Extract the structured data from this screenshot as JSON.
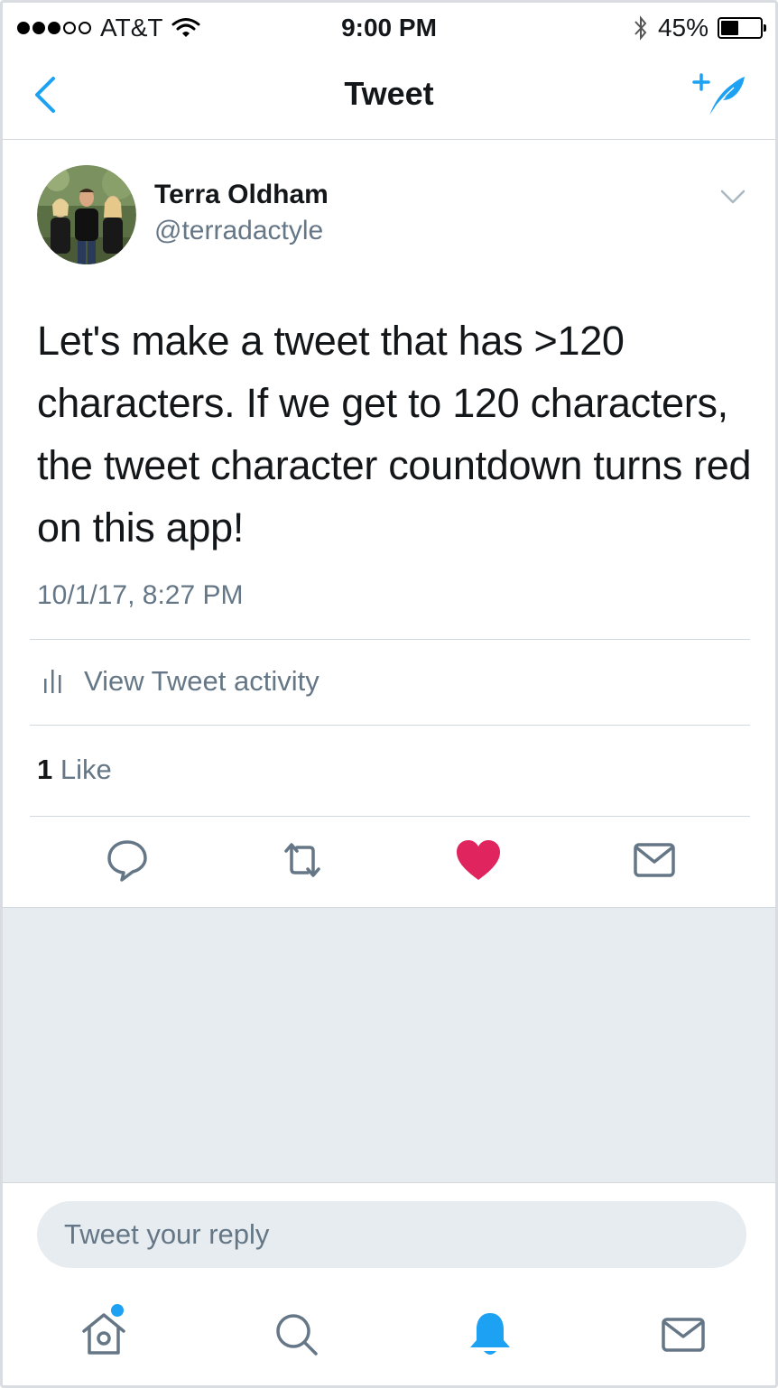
{
  "status_bar": {
    "carrier": "AT&T",
    "time": "9:00 PM",
    "battery": "45%",
    "battery_level": 0.45
  },
  "nav": {
    "title": "Tweet",
    "back_icon": "chevron-left-icon",
    "compose_icon": "compose-tweet-icon"
  },
  "tweet": {
    "author_name": "Terra Oldham",
    "author_handle": "@terradactyle",
    "text": "Let's make a tweet that has >120 characters. If we get to 120 characters, the tweet character countdown turns red on this app!",
    "timestamp": "10/1/17, 8:27 PM",
    "activity_label": "View Tweet activity",
    "like_count": "1",
    "like_label": "Like"
  },
  "actions": [
    "reply-icon",
    "retweet-icon",
    "like-icon",
    "direct-message-icon"
  ],
  "reply_box": {
    "placeholder": "Tweet your reply"
  },
  "tab_bar": [
    "home-icon",
    "search-icon",
    "notifications-icon",
    "messages-icon"
  ],
  "colors": {
    "accent": "#1da1f2",
    "like": "#e0245e",
    "secondary_text": "#657786",
    "background_gray": "#e6ecf0"
  }
}
